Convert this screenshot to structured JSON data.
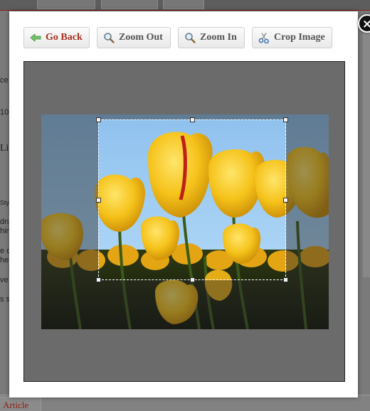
{
  "background": {
    "left_fragments": [
      "ce",
      "10",
      "Li",
      "Styl",
      "dn",
      "hin",
      "e c",
      "her",
      "ve",
      "s s"
    ],
    "article_label": "Article"
  },
  "modal": {
    "close_label": "×",
    "toolbar": {
      "go_back": "Go Back",
      "zoom_out": "Zoom Out",
      "zoom_in": "Zoom In",
      "crop_image": "Crop Image"
    },
    "icons": {
      "go_back": "arrow-left-icon",
      "zoom_out": "magnifier-icon",
      "zoom_in": "magnifier-icon",
      "crop_image": "scissors-icon",
      "close": "close-icon"
    },
    "colors": {
      "go_back_text": "#a5311f",
      "button_text": "#555555",
      "stage_bg": "#6b6b6b",
      "sky": "#8fc1ee",
      "tulip": "#f5c21a"
    }
  }
}
